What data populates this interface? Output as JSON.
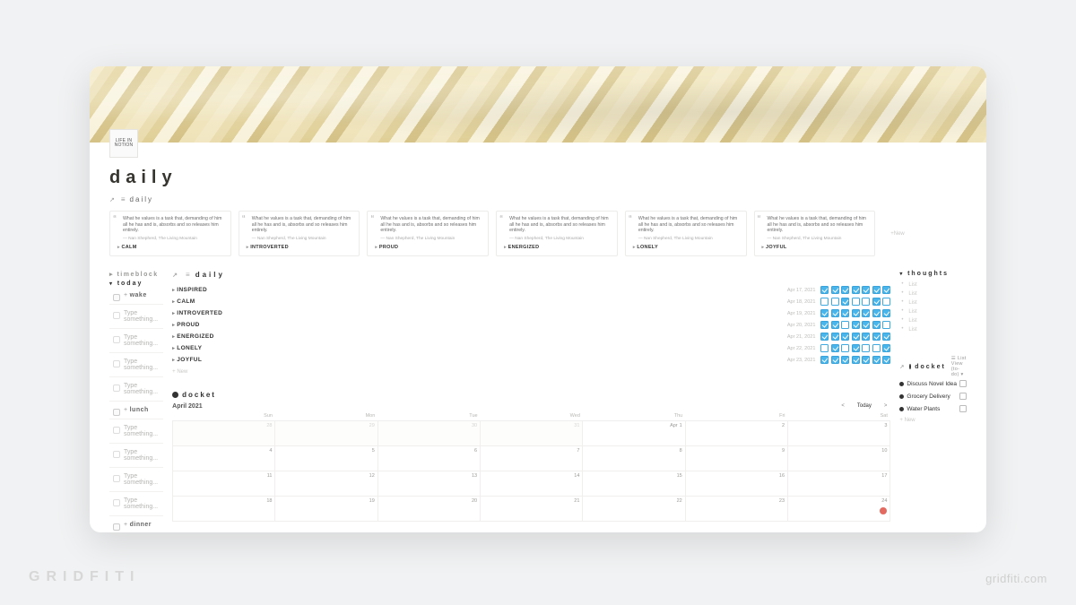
{
  "watermarks": {
    "left": "GRIDFITI",
    "right": "gridfiti.com"
  },
  "page": {
    "icon_label": "LIFE\nIN\nNOTION",
    "title": "daily",
    "breadcrumb": "daily"
  },
  "quotes": {
    "text": "What he values is a task that, demanding of him all he has and is, absorbs and so releases him entirely.",
    "attribution": "— Nan Shepherd, The Living Mountain",
    "tags": [
      "CALM",
      "INTROVERTED",
      "PROUD",
      "ENERGIZED",
      "LONELY",
      "JOYFUL"
    ],
    "new_label": "New"
  },
  "timeblock": {
    "label": "timeblock",
    "today_label": "today",
    "placeholder": "Type something...",
    "items": [
      "wake",
      "lunch",
      "dinner"
    ],
    "rows_before_lunch": 4,
    "rows_between": 4
  },
  "daily_tracker": {
    "header": "daily",
    "new_label": "New",
    "rows": [
      {
        "name": "INSPIRED",
        "date": "Apr 17, 2021",
        "checks": [
          true,
          true,
          true,
          true,
          true,
          true,
          true
        ]
      },
      {
        "name": "CALM",
        "date": "Apr 18, 2021",
        "checks": [
          false,
          false,
          true,
          false,
          false,
          true,
          false
        ]
      },
      {
        "name": "INTROVERTED",
        "date": "Apr 19, 2021",
        "checks": [
          true,
          true,
          true,
          true,
          true,
          true,
          true
        ]
      },
      {
        "name": "PROUD",
        "date": "Apr 20, 2021",
        "checks": [
          true,
          true,
          false,
          true,
          true,
          true,
          false
        ]
      },
      {
        "name": "ENERGIZED",
        "date": "Apr 21, 2021",
        "checks": [
          true,
          true,
          true,
          true,
          true,
          true,
          true
        ]
      },
      {
        "name": "LONELY",
        "date": "Apr 22, 2021",
        "checks": [
          false,
          true,
          false,
          true,
          false,
          false,
          true
        ]
      },
      {
        "name": "JOYFUL",
        "date": "Apr 23, 2021",
        "checks": [
          true,
          true,
          true,
          true,
          true,
          true,
          true
        ]
      }
    ]
  },
  "calendar": {
    "header": "docket",
    "month": "April 2021",
    "today_label": "Today",
    "prev": "<",
    "next": ">",
    "days": [
      "Sun",
      "Mon",
      "Tue",
      "Wed",
      "Thu",
      "Fri",
      "Sat"
    ],
    "weeks": [
      [
        {
          "n": 28,
          "out": true
        },
        {
          "n": 29,
          "out": true
        },
        {
          "n": 30,
          "out": true
        },
        {
          "n": 31,
          "out": true
        },
        {
          "n": 1,
          "first": true,
          "mon": "Apr"
        },
        {
          "n": 2
        },
        {
          "n": 3
        }
      ],
      [
        {
          "n": 4
        },
        {
          "n": 5
        },
        {
          "n": 6
        },
        {
          "n": 7
        },
        {
          "n": 8
        },
        {
          "n": 9
        },
        {
          "n": 10
        }
      ],
      [
        {
          "n": 11
        },
        {
          "n": 12
        },
        {
          "n": 13
        },
        {
          "n": 14
        },
        {
          "n": 15
        },
        {
          "n": 16
        },
        {
          "n": 17
        }
      ],
      [
        {
          "n": 18
        },
        {
          "n": 19
        },
        {
          "n": 20
        },
        {
          "n": 21
        },
        {
          "n": 22
        },
        {
          "n": 23
        },
        {
          "n": 24
        }
      ]
    ]
  },
  "thoughts": {
    "header": "thoughts",
    "placeholder": "List",
    "count": 6
  },
  "docket_side": {
    "header": "docket",
    "view_label": "List View (to-do)",
    "new_label": "New",
    "tasks": [
      "Discuss Novel Idea",
      "Grocery Delivery",
      "Water Plants"
    ]
  }
}
